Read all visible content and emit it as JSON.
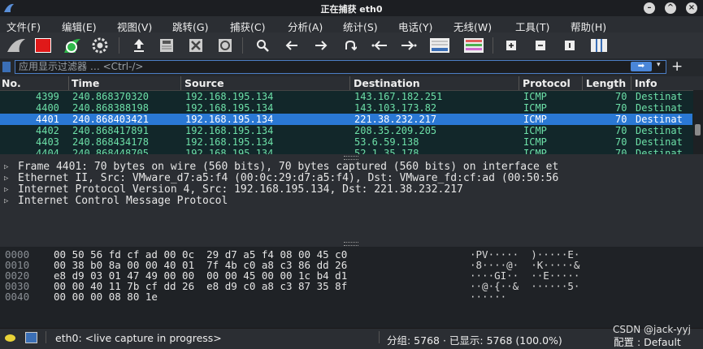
{
  "window": {
    "title": "正在捕获 eth0"
  },
  "menu": [
    "文件(F)",
    "编辑(E)",
    "视图(V)",
    "跳转(G)",
    "捕获(C)",
    "分析(A)",
    "统计(S)",
    "电话(Y)",
    "无线(W)",
    "工具(T)",
    "帮助(H)"
  ],
  "filter": {
    "placeholder": "应用显示过滤器 … <Ctrl-/>",
    "apply_glyph": "➡",
    "dropdown_glyph": "▾",
    "add_glyph": "+"
  },
  "columns": [
    "No.",
    "Time",
    "Source",
    "Destination",
    "Protocol",
    "Length",
    "Info"
  ],
  "packets": [
    {
      "no": "4399",
      "time": "240.868370320",
      "src": "192.168.195.134",
      "dst": "143.167.182.251",
      "proto": "ICMP",
      "len": "70",
      "info": "Destinat"
    },
    {
      "no": "4400",
      "time": "240.868388198",
      "src": "192.168.195.134",
      "dst": "143.103.173.82",
      "proto": "ICMP",
      "len": "70",
      "info": "Destinat"
    },
    {
      "no": "4401",
      "time": "240.868403421",
      "src": "192.168.195.134",
      "dst": "221.38.232.217",
      "proto": "ICMP",
      "len": "70",
      "info": "Destinat"
    },
    {
      "no": "4402",
      "time": "240.868417891",
      "src": "192.168.195.134",
      "dst": "208.35.209.205",
      "proto": "ICMP",
      "len": "70",
      "info": "Destinat"
    },
    {
      "no": "4403",
      "time": "240.868434178",
      "src": "192.168.195.134",
      "dst": "53.6.59.138",
      "proto": "ICMP",
      "len": "70",
      "info": "Destinat"
    },
    {
      "no": "4404",
      "time": "240.868448705",
      "src": "192.168.195.134",
      "dst": "52.1.35.178",
      "proto": "ICMP",
      "len": "70",
      "info": "Destinat"
    }
  ],
  "details": [
    "Frame 4401: 70 bytes on wire (560 bits), 70 bytes captured (560 bits) on interface et",
    "Ethernet II, Src: VMware_d7:a5:f4 (00:0c:29:d7:a5:f4), Dst: VMware_fd:cf:ad (00:50:56",
    "Internet Protocol Version 4, Src: 192.168.195.134, Dst: 221.38.232.217",
    "Internet Control Message Protocol"
  ],
  "bytes": [
    {
      "off": "0000",
      "hex": "00 50 56 fd cf ad 00 0c  29 d7 a5 f4 08 00 45 c0",
      "ascii": "·PV·····  )·····E·"
    },
    {
      "off": "0010",
      "hex": "00 38 b0 8a 00 00 40 01  7f 4b c0 a8 c3 86 dd 26",
      "ascii": "·8····@·  ·K·····&"
    },
    {
      "off": "0020",
      "hex": "e8 d9 03 01 47 49 00 00  00 00 45 00 00 1c b4 d1",
      "ascii": "····GI··  ··E·····"
    },
    {
      "off": "0030",
      "hex": "00 00 40 11 7b cf dd 26  e8 d9 c0 a8 c3 87 35 8f",
      "ascii": "··@·{··&  ······5·"
    },
    {
      "off": "0040",
      "hex": "00 00 00 08 80 1e",
      "ascii": "······"
    }
  ],
  "status": {
    "capture": "eth0: <live capture in progress>",
    "counts": "分组: 5768 · 已显示: 5768 (100.0%)",
    "profile": "配置 : Default"
  },
  "watermark": "CSDN @jack-yyj",
  "colors": {
    "selected_row": "#2a78d4",
    "icmp_row_bg": "#12272a",
    "icmp_row_fg": "#6de0a8"
  }
}
